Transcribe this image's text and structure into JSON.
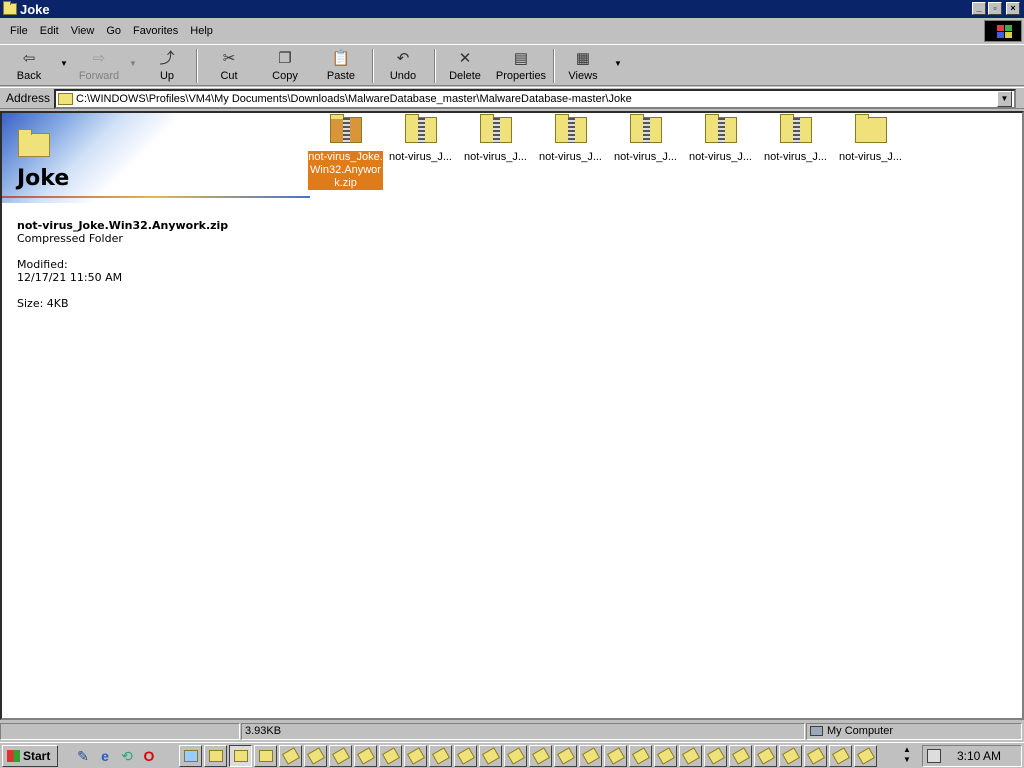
{
  "window": {
    "title": "Joke"
  },
  "menu": [
    "File",
    "Edit",
    "View",
    "Go",
    "Favorites",
    "Help"
  ],
  "toolbar": {
    "back": "Back",
    "forward": "Forward",
    "up": "Up",
    "cut": "Cut",
    "copy": "Copy",
    "paste": "Paste",
    "undo": "Undo",
    "delete": "Delete",
    "properties": "Properties",
    "views": "Views"
  },
  "address": {
    "label": "Address",
    "value": "C:\\WINDOWS\\Profiles\\VM4\\My Documents\\Downloads\\MalwareDatabase_master\\MalwareDatabase-master\\Joke"
  },
  "webview": {
    "folder_title": "Joke",
    "file_name": "not-virus_Joke.Win32.Anywork.zip",
    "file_type": "Compressed Folder",
    "modified_label": "Modified:",
    "modified_value": "12/17/21 11:50 AM",
    "size": "Size: 4KB"
  },
  "files": [
    {
      "label": "not-virus_Joke.Win32.Anywork.zip",
      "selected": true,
      "zip": true
    },
    {
      "label": "not-virus_J...",
      "selected": false,
      "zip": true
    },
    {
      "label": "not-virus_J...",
      "selected": false,
      "zip": true
    },
    {
      "label": "not-virus_J...",
      "selected": false,
      "zip": true
    },
    {
      "label": "not-virus_J...",
      "selected": false,
      "zip": true
    },
    {
      "label": "not-virus_J...",
      "selected": false,
      "zip": true
    },
    {
      "label": "not-virus_J...",
      "selected": false,
      "zip": true
    },
    {
      "label": "not-virus_J...",
      "selected": false,
      "zip": false
    }
  ],
  "status": {
    "size": "3.93KB",
    "zone": "My Computer"
  },
  "taskbar": {
    "start": "Start",
    "clock": "3:10 AM"
  },
  "icons": {
    "back": "back-arrow-icon",
    "forward": "forward-arrow-icon",
    "up": "folder-up-icon",
    "cut": "scissors-icon",
    "copy": "copy-icon",
    "paste": "paste-icon",
    "undo": "undo-icon",
    "delete": "delete-x-icon",
    "properties": "properties-icon",
    "views": "views-icon"
  },
  "colors": {
    "titlebar": "#0a246a",
    "selection": "#e07b1a"
  }
}
